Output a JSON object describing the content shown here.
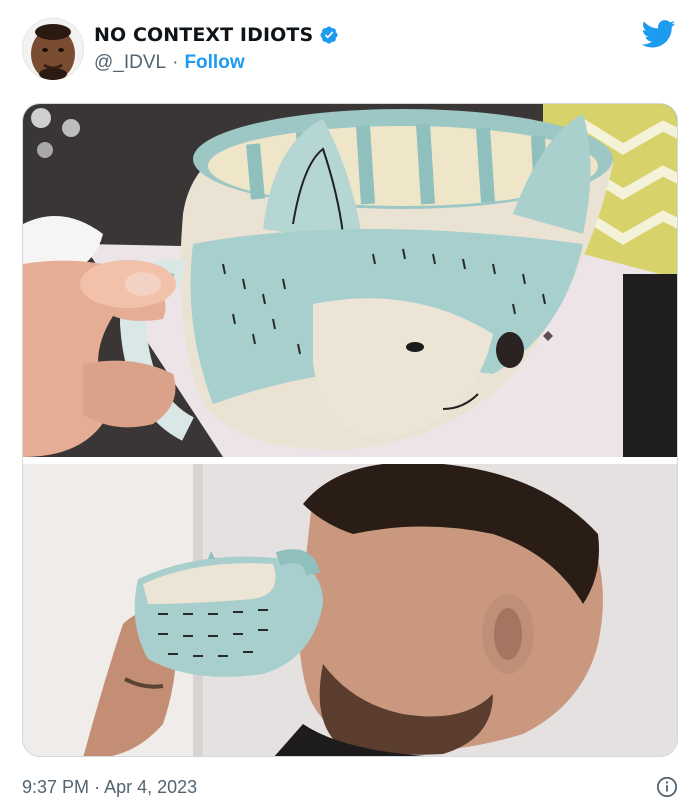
{
  "tweet": {
    "display_name": "NO CONTEXT IDIOTS",
    "handle": "@_IDVL",
    "separator": "·",
    "follow_label": "Follow",
    "time": "9:37 PM",
    "date": "Apr 4, 2023",
    "verified_icon": "verified-badge-icon",
    "brand_icon": "twitter-bird-icon",
    "info_icon": "info-icon"
  },
  "colors": {
    "accent": "#1d9bf0",
    "text_primary": "#0f1419",
    "text_secondary": "#536471",
    "border": "#cfd9de"
  }
}
